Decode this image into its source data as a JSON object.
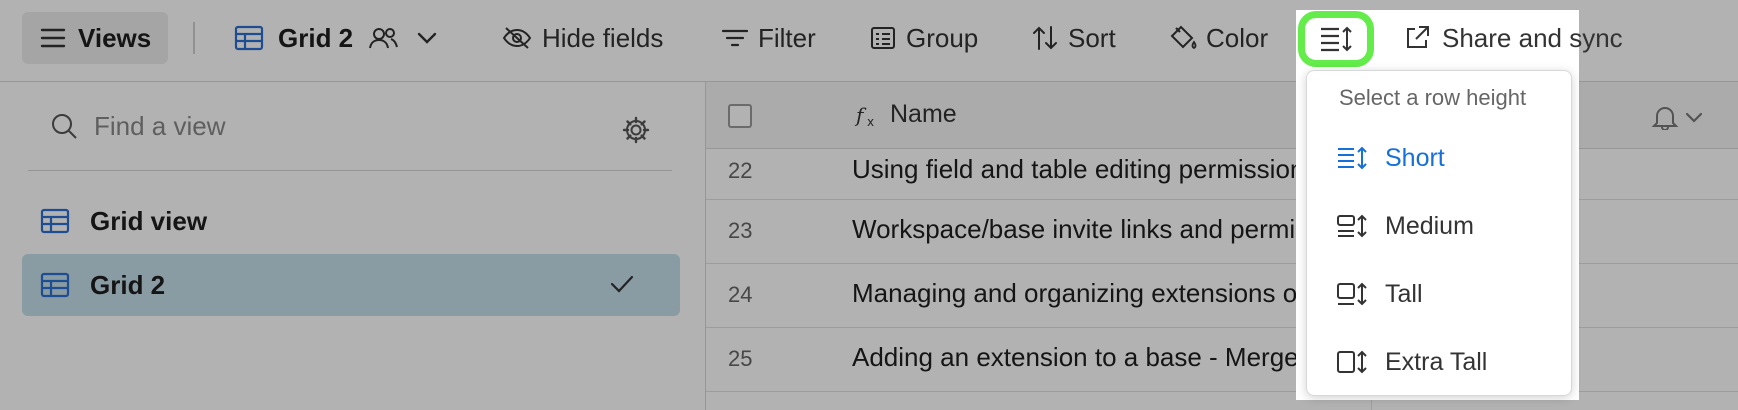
{
  "toolbar": {
    "views_label": "Views",
    "current_view": "Grid 2",
    "hide_fields_label": "Hide fields",
    "filter_label": "Filter",
    "group_label": "Group",
    "sort_label": "Sort",
    "color_label": "Color",
    "share_label": "Share and sync"
  },
  "sidebar": {
    "search_placeholder": "Find a view",
    "views": [
      {
        "label": "Grid view"
      },
      {
        "label": "Grid 2"
      }
    ]
  },
  "grid": {
    "name_column": "Name",
    "rows": [
      {
        "num": "22",
        "name": "Using field and table editing permissions"
      },
      {
        "num": "23",
        "name": "Workspace/base invite links and permissions"
      },
      {
        "num": "24",
        "name": "Managing and organizing extensions on"
      },
      {
        "num": "25",
        "name": "Adding an extension to a base - Merge"
      }
    ]
  },
  "row_height_menu": {
    "title": "Select a row height",
    "options": [
      {
        "label": "Short"
      },
      {
        "label": "Medium"
      },
      {
        "label": "Tall"
      },
      {
        "label": "Extra Tall"
      }
    ],
    "selected": "Short"
  },
  "colors": {
    "accent_blue": "#1570d8",
    "highlight_green": "#63ec4a",
    "selected_view_bg": "#c5dfea"
  }
}
